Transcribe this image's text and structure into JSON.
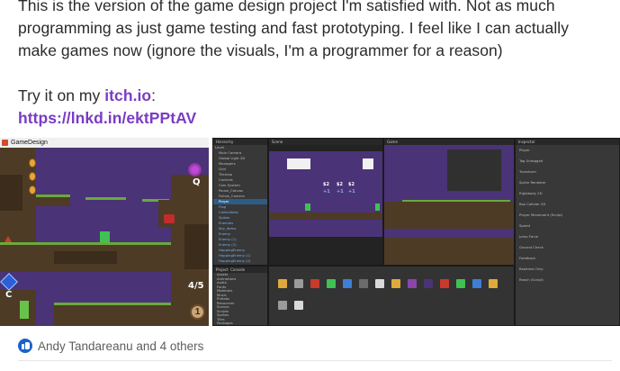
{
  "post": {
    "line1": "This is the version of the game design project I'm satisfied with. Not as much",
    "line2": "programming as just game testing and fast prototyping. I feel like I can actually",
    "line3": "make games now (ignore the visuals, I'm a programmer for a reason)",
    "try_prefix": "Try it on my ",
    "itch_link": "itch.io",
    "try_suffix": ":",
    "short_link": "https://lnkd.in/ektPPtAV"
  },
  "game_window": {
    "title": "GameDesign",
    "hud_key_q": "Q",
    "hud_key_c": "C",
    "hud_counter": "4/5",
    "round_badge": "1"
  },
  "editor": {
    "hierarchy_tab": "Hierarchy",
    "scene_tab": "Scene",
    "game_tab": "Game",
    "inspector_tab": "Inspector",
    "project_tab": "Project",
    "console_tab": "Console",
    "hierarchy_items": [
      "Level",
      "Main Camera",
      "Global Light 2D",
      "Managers",
      "Grid",
      "Tilemap",
      "Controls",
      "Coin System",
      "Pause_Canvas",
      "Follow_Camera",
      "Player",
      "Flag",
      "Collectibles",
      "Spikes",
      "Enemies",
      "Key_Items",
      "Enemy",
      "Enemy (1)",
      "Enemy (2)",
      "HoppingEnemy",
      "HoppingEnemy (1)",
      "HoppingEnemy (2)",
      "HoppingEnemy (3)",
      "HoppingEnemy (4)"
    ],
    "selected_index": 10,
    "project_items": [
      "Assets",
      "Animations",
      "Audio",
      "Fonts",
      "Materials",
      "Music",
      "Prefabs",
      "Resources",
      "Scenes",
      "Scripts",
      "Sprites",
      "Tiles",
      "Packages"
    ],
    "inspector_rows": [
      "Player",
      "Tag Untagged",
      "Transform",
      "Sprite Renderer",
      "Rigidbody 2D",
      "Box Collider 2D",
      "Player Movement (Script)",
      "Speed",
      "Jump Force",
      "Ground Check",
      "Feedback",
      "Realtime Only",
      "Reach (Script)"
    ],
    "score_labels": [
      "$2",
      "$2",
      "$2",
      "+1",
      "+1",
      "+1"
    ]
  },
  "reactions": {
    "text": "Andy Tandareanu and 4 others"
  },
  "colors": {
    "link": "#7a3cc4",
    "like_blue": "#1b62c8",
    "game_sky": "#4a3377",
    "dirt": "#4e3b26",
    "grass": "#6aa93c"
  }
}
